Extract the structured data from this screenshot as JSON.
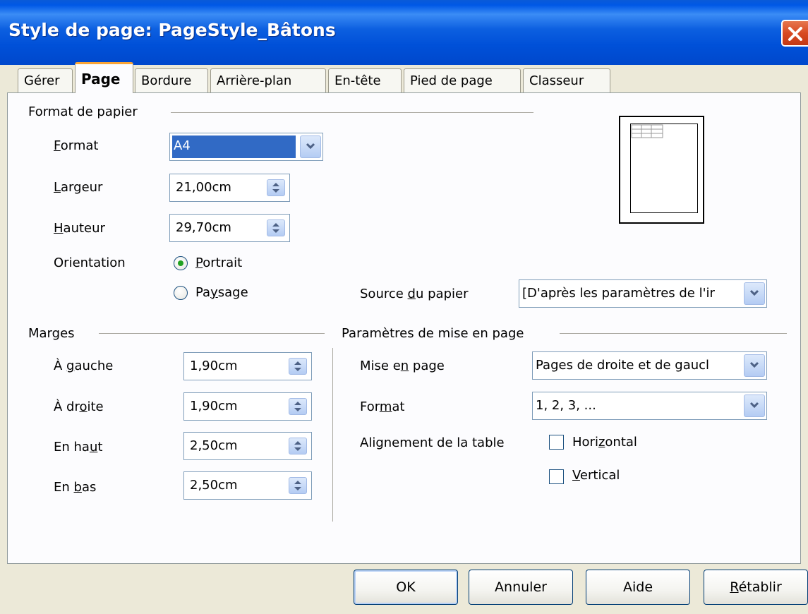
{
  "window": {
    "title": "Style de page: PageStyle_Bâtons"
  },
  "tabs": [
    {
      "label": "Gérer"
    },
    {
      "label": "Page"
    },
    {
      "label": "Bordure"
    },
    {
      "label": "Arrière-plan"
    },
    {
      "label": "En-tête"
    },
    {
      "label": "Pied de page"
    },
    {
      "label": "Classeur"
    }
  ],
  "paper_format": {
    "group_title": "Format de papier",
    "format_label": "Format",
    "format_value": "A4",
    "width_label": "Largeur",
    "width_value": "21,00cm",
    "height_label": "Hauteur",
    "height_value": "29,70cm",
    "orientation_label": "Orientation",
    "portrait_label": "Portrait",
    "landscape_label": "Paysage",
    "orientation_selected": "Portrait",
    "source_label": "Source du papier",
    "source_value": "[D'après les paramètres de l'ir"
  },
  "margins": {
    "group_title": "Marges",
    "left_label": "À gauche",
    "left_value": "1,90cm",
    "right_label": "À droite",
    "right_value": "1,90cm",
    "top_label": "En haut",
    "top_value": "2,50cm",
    "bottom_label": "En bas",
    "bottom_value": "2,50cm"
  },
  "layout": {
    "group_title": "Paramètres de mise en page",
    "layout_label": "Mise en page",
    "layout_value": "Pages de droite et de gaucl",
    "format_label": "Format",
    "format_value": "1, 2, 3, ...",
    "table_align_label": "Alignement de la table",
    "horizontal_label": "Horizontal",
    "vertical_label": "Vertical",
    "horizontal_checked": false,
    "vertical_checked": false
  },
  "buttons": {
    "ok": "OK",
    "cancel": "Annuler",
    "help": "Aide",
    "reset": "Rétablir"
  },
  "colors": {
    "titlebar": "#0054e3",
    "dialog_bg": "#ece9d8",
    "selection": "#316ac5",
    "active_tab_accent": "#f9a435"
  }
}
